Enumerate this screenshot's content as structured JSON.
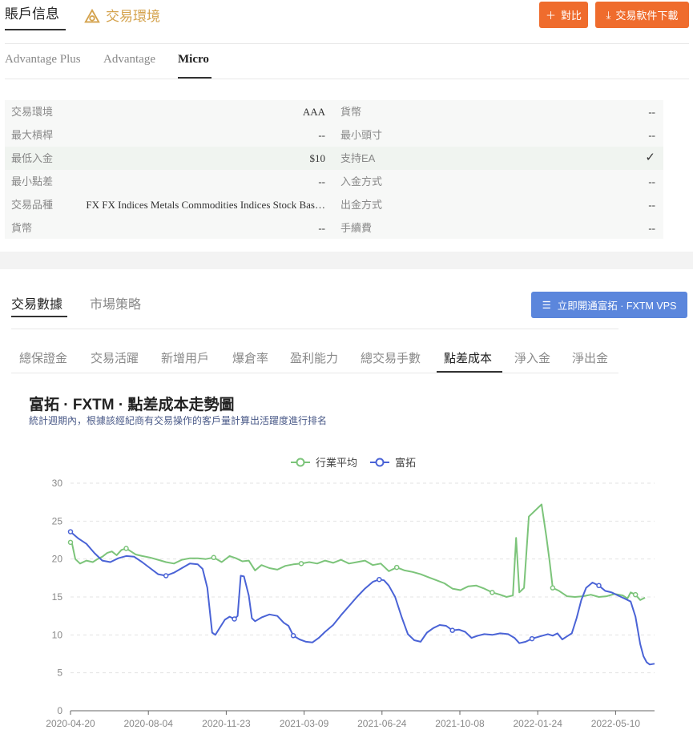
{
  "header": {
    "tab_account": "賬戶信息",
    "tab_env": "交易環境",
    "compare_label": "對比",
    "download_label": "交易軟件下載"
  },
  "account_types": [
    "Advantage Plus",
    "Advantage",
    "Micro"
  ],
  "info": [
    {
      "k1": "交易環境",
      "v1": "AAA",
      "k2": "貨幣",
      "v2": "--"
    },
    {
      "k1": "最大槓桿",
      "v1": "--",
      "k2": "最小頭寸",
      "v2": "--"
    },
    {
      "k1": "最低入金",
      "v1": "$10",
      "k2": "支持EA",
      "v2": "✓"
    },
    {
      "k1": "最小點差",
      "v1": "--",
      "k2": "入金方式",
      "v2": "--"
    },
    {
      "k1": "交易品種",
      "v1": "FX FX Indices Metals Commodities Indices Stock Bas…",
      "k2": "出金方式",
      "v2": "--"
    },
    {
      "k1": "貨幣",
      "v1": "--",
      "k2": "手續費",
      "v2": "--"
    }
  ],
  "data_section": {
    "tab_data": "交易數據",
    "tab_strategy": "市場策略",
    "vps_label": "立即開通富拓 · FXTM VPS"
  },
  "metric_tabs": [
    "總保證金",
    "交易活躍",
    "新增用戶",
    "爆倉率",
    "盈利能力",
    "總交易手數",
    "點差成本",
    "淨入金",
    "淨出金"
  ],
  "chart": {
    "title": "富拓 · FXTM · 點差成本走勢圖",
    "subtitle": "統計週期內，根據該經紀商有交易操作的客戶量計算出活躍度進行排名"
  },
  "colors": {
    "accent_orange": "#ef6c2d",
    "accent_blue": "#5b86dc",
    "industry": "#7cc47a",
    "broker": "#4a63d6"
  },
  "chart_data": {
    "type": "line",
    "x_labels": [
      "2020-04-20",
      "2020-08-04",
      "2020-11-23",
      "2021-03-09",
      "2021-06-24",
      "2021-10-08",
      "2022-01-24",
      "2022-05-10"
    ],
    "ylim": [
      0,
      30
    ],
    "yticks": [
      0,
      5,
      10,
      15,
      20,
      25,
      30
    ],
    "legend": "top-center",
    "grid": "horizontal-dashed",
    "series": [
      {
        "name": "行業平均",
        "color": "#7cc47a",
        "points": [
          [
            0,
            22.2
          ],
          [
            0.1,
            22
          ],
          [
            0.3,
            20
          ],
          [
            0.6,
            19.4
          ],
          [
            1,
            19.8
          ],
          [
            1.4,
            19.6
          ],
          [
            1.7,
            20
          ],
          [
            2,
            20.3
          ],
          [
            2.3,
            20.8
          ],
          [
            2.6,
            21
          ],
          [
            2.9,
            20.5
          ],
          [
            3.2,
            21.2
          ],
          [
            3.5,
            21.4
          ],
          [
            3.8,
            21
          ],
          [
            4.1,
            20.6
          ],
          [
            4.5,
            20.4
          ],
          [
            5,
            20.2
          ],
          [
            5.5,
            19.9
          ],
          [
            6,
            19.6
          ],
          [
            6.5,
            19.4
          ],
          [
            7,
            19.9
          ],
          [
            7.5,
            20.1
          ],
          [
            8,
            20.1
          ],
          [
            8.5,
            20
          ],
          [
            9,
            20.2
          ],
          [
            9.5,
            19.6
          ],
          [
            10,
            20.4
          ],
          [
            10.4,
            20.1
          ],
          [
            10.8,
            19.7
          ],
          [
            11.2,
            19.8
          ],
          [
            11.6,
            18.5
          ],
          [
            12,
            19.2
          ],
          [
            12.5,
            18.8
          ],
          [
            13,
            18.6
          ],
          [
            13.5,
            19.1
          ],
          [
            14,
            19.3
          ],
          [
            14.5,
            19.4
          ],
          [
            15,
            19.6
          ],
          [
            15.5,
            19.4
          ],
          [
            16,
            19.8
          ],
          [
            16.5,
            19.5
          ],
          [
            17,
            19.9
          ],
          [
            17.5,
            19.4
          ],
          [
            18,
            19.6
          ],
          [
            18.5,
            19.8
          ],
          [
            19,
            19.2
          ],
          [
            19.5,
            19.4
          ],
          [
            20,
            18.4
          ],
          [
            20.5,
            18.9
          ],
          [
            21,
            18.5
          ],
          [
            21.5,
            18.3
          ],
          [
            22,
            18
          ],
          [
            22.5,
            17.6
          ],
          [
            23,
            17.2
          ],
          [
            23.5,
            16.8
          ],
          [
            24,
            16.1
          ],
          [
            24.5,
            15.9
          ],
          [
            25,
            16.4
          ],
          [
            25.5,
            16.5
          ],
          [
            26,
            16.1
          ],
          [
            26.5,
            15.6
          ],
          [
            27,
            15.3
          ],
          [
            27.4,
            15
          ],
          [
            27.8,
            15.2
          ],
          [
            28,
            22.8
          ],
          [
            28.2,
            15.6
          ],
          [
            28.5,
            16.2
          ],
          [
            28.8,
            25.6
          ],
          [
            29.2,
            26.4
          ],
          [
            29.6,
            27.2
          ],
          [
            29.9,
            23
          ],
          [
            30.1,
            19.8
          ],
          [
            30.3,
            16.2
          ],
          [
            30.7,
            15.8
          ],
          [
            31.2,
            15.1
          ],
          [
            31.7,
            15
          ],
          [
            32.2,
            15.1
          ],
          [
            32.7,
            15.3
          ],
          [
            33.2,
            15
          ],
          [
            33.7,
            15.1
          ],
          [
            34.2,
            15.4
          ],
          [
            34.7,
            15.2
          ],
          [
            35,
            14.8
          ],
          [
            35.2,
            15.6
          ],
          [
            35.5,
            15.3
          ],
          [
            35.8,
            14.6
          ],
          [
            36.1,
            14.9
          ]
        ]
      },
      {
        "name": "富拓",
        "color": "#4a63d6",
        "points": [
          [
            0,
            23.6
          ],
          [
            0.5,
            22.7
          ],
          [
            1,
            22
          ],
          [
            1.5,
            20.8
          ],
          [
            2,
            19.8
          ],
          [
            2.5,
            19.6
          ],
          [
            3,
            20.1
          ],
          [
            3.5,
            20.4
          ],
          [
            4,
            20.3
          ],
          [
            4.5,
            19.6
          ],
          [
            5,
            18.8
          ],
          [
            5.5,
            18
          ],
          [
            6,
            17.8
          ],
          [
            6.5,
            18.2
          ],
          [
            7,
            18.8
          ],
          [
            7.5,
            19.4
          ],
          [
            8,
            19.3
          ],
          [
            8.3,
            18.7
          ],
          [
            8.6,
            16.2
          ],
          [
            8.9,
            10.3
          ],
          [
            9.1,
            10
          ],
          [
            9.4,
            11
          ],
          [
            9.7,
            12
          ],
          [
            10,
            12.4
          ],
          [
            10.3,
            12.1
          ],
          [
            10.5,
            12.5
          ],
          [
            10.7,
            17.8
          ],
          [
            10.9,
            17.7
          ],
          [
            11.2,
            15.2
          ],
          [
            11.4,
            12.2
          ],
          [
            11.6,
            11.8
          ],
          [
            12,
            12.3
          ],
          [
            12.5,
            12.7
          ],
          [
            13,
            12.5
          ],
          [
            13.4,
            11.6
          ],
          [
            13.7,
            11.2
          ],
          [
            14,
            9.9
          ],
          [
            14.4,
            9.4
          ],
          [
            14.8,
            9.1
          ],
          [
            15.2,
            9
          ],
          [
            15.6,
            9.6
          ],
          [
            16,
            10.4
          ],
          [
            16.5,
            11.3
          ],
          [
            17,
            12.6
          ],
          [
            17.5,
            13.8
          ],
          [
            18,
            15
          ],
          [
            18.5,
            16.1
          ],
          [
            19,
            17
          ],
          [
            19.4,
            17.3
          ],
          [
            19.7,
            17.2
          ],
          [
            20,
            16.5
          ],
          [
            20.4,
            15
          ],
          [
            20.8,
            12.4
          ],
          [
            21.2,
            10.1
          ],
          [
            21.6,
            9.3
          ],
          [
            22,
            9.1
          ],
          [
            22.4,
            10.3
          ],
          [
            22.8,
            10.9
          ],
          [
            23.2,
            11.3
          ],
          [
            23.6,
            11.2
          ],
          [
            24,
            10.6
          ],
          [
            24.4,
            10.7
          ],
          [
            24.8,
            10.4
          ],
          [
            25.2,
            9.6
          ],
          [
            25.6,
            9.9
          ],
          [
            26,
            10.1
          ],
          [
            26.5,
            10
          ],
          [
            27,
            10.2
          ],
          [
            27.5,
            10.1
          ],
          [
            27.9,
            9.6
          ],
          [
            28.2,
            8.9
          ],
          [
            28.6,
            9.1
          ],
          [
            29,
            9.5
          ],
          [
            29.5,
            9.8
          ],
          [
            30,
            10.1
          ],
          [
            30.3,
            9.9
          ],
          [
            30.6,
            10.2
          ],
          [
            30.9,
            9.4
          ],
          [
            31.2,
            9.8
          ],
          [
            31.5,
            10.2
          ],
          [
            31.8,
            12.2
          ],
          [
            32.1,
            14.6
          ],
          [
            32.4,
            16.2
          ],
          [
            32.8,
            16.9
          ],
          [
            33.2,
            16.5
          ],
          [
            33.6,
            15.8
          ],
          [
            34,
            15.6
          ],
          [
            34.4,
            15.2
          ],
          [
            34.8,
            14.8
          ],
          [
            35.2,
            14.4
          ],
          [
            35.5,
            12.4
          ],
          [
            35.8,
            8.8
          ],
          [
            36,
            7.2
          ],
          [
            36.2,
            6.4
          ],
          [
            36.4,
            6.1
          ],
          [
            36.7,
            6.2
          ]
        ]
      }
    ]
  }
}
